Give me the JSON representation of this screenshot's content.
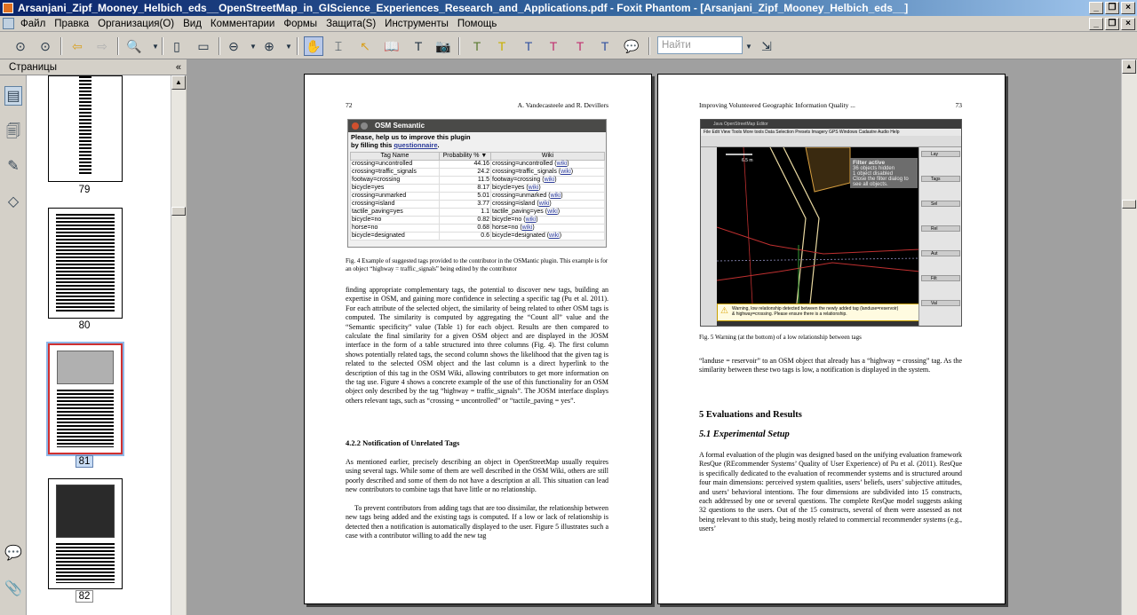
{
  "window": {
    "title": "Arsanjani_Zipf_Mooney_Helbich_eds__OpenStreetMap_in_GIScience_Experiences_Research_and_Applications.pdf - Foxit Phantom - [Arsanjani_Zipf_Mooney_Helbich_eds__]",
    "minimize": "_",
    "restore": "❐",
    "close": "×"
  },
  "menu": {
    "items": [
      "Файл",
      "Правка",
      "Организация(O)",
      "Вид",
      "Комментарии",
      "Формы",
      "Защита(S)",
      "Инструменты",
      "Помощь"
    ]
  },
  "toolbar": {
    "search_placeholder": "Найти",
    "icons": [
      "nav-up-icon",
      "nav-down-icon",
      "back-icon",
      "forward-icon",
      "zoom-icon",
      "fit-page-icon",
      "fit-width-icon",
      "zoom-out-icon",
      "zoom-in-icon",
      "hand-icon",
      "select-text-icon",
      "select-icon",
      "snapshot-icon",
      "typewriter-icon",
      "text-box-icon",
      "highlight-icon",
      "note-icon",
      "underline-icon",
      "strikeout-icon",
      "replace-icon",
      "squiggly-icon",
      "comment-icon"
    ]
  },
  "sidebar": {
    "title": "Страницы",
    "collapse": "«",
    "tabs": [
      "pages-icon",
      "bookmarks-icon",
      "signatures-icon",
      "layers-icon",
      "comments-icon",
      "attachments-icon"
    ],
    "thumbnails": [
      {
        "label": "79"
      },
      {
        "label": "80"
      },
      {
        "label": "81",
        "selected": true
      },
      {
        "label": "82"
      }
    ]
  },
  "left_page": {
    "page_number": "72",
    "running_head": "A. Vandecasteele and R. Devillers",
    "plugin": {
      "title": "OSM Semantic",
      "please_line1": "Please, help us to improve this plugin",
      "please_line2_prefix": "by filling this ",
      "please_link": "questionnaire",
      "please_suffix": ".",
      "columns": [
        "Tag Name",
        "Probability % ▼",
        "Wiki"
      ],
      "rows": [
        [
          "crossing=uncontrolled",
          "44.16",
          "crossing=uncontrolled",
          "wiki"
        ],
        [
          "crossing=traffic_signals",
          "24.2",
          "crossing=traffic_signals",
          "wiki"
        ],
        [
          "footway=crossing",
          "11.5",
          "footway=crossing",
          "wiki"
        ],
        [
          "bicycle=yes",
          "8.17",
          "bicycle=yes",
          "wiki"
        ],
        [
          "crossing=unmarked",
          "5.01",
          "crossing=unmarked",
          "wiki"
        ],
        [
          "crossing=island",
          "3.77",
          "crossing=island",
          "wiki"
        ],
        [
          "tactile_paving=yes",
          "1.1",
          "tactile_paving=yes",
          "wiki"
        ],
        [
          "bicycle=no",
          "0.82",
          "bicycle=no",
          "wiki"
        ],
        [
          "horse=no",
          "0.68",
          "horse=no",
          "wiki"
        ],
        [
          "bicycle=designated",
          "0.6",
          "bicycle=designated",
          "wiki"
        ]
      ]
    },
    "fig4_caption": "Fig. 4  Example of suggested tags provided to the contributor in the OSMantic plugin. This example is for an object “highway = traffic_signals” being edited by the contributor",
    "para1": "finding appropriate complementary tags, the potential to discover new tags, building an expertise in OSM, and gaining more confidence in selecting a specific tag (Pu et al. 2011). For each attribute of the selected object, the similarity of being related to other OSM tags is computed. The similarity is computed by aggregating the “Count all” value and the “Semantic specificity” value (Table 1) for each object. Results are then compared to calculate the final similarity for a given OSM object and are displayed in the JOSM interface in the form of a table structured into three columns (Fig. 4). The first column shows potentially related tags, the second column shows the likelihood that the given tag is related to the selected OSM object and the last column is a direct hyperlink to the description of this tag in the OSM Wiki, allowing contributors to get more information on the tag use. Figure 4 shows a concrete example of the use of this functionality for an OSM object only described by the tag “highway = traffic_signals”. The JOSM interface displays others relevant tags, such as “crossing = uncontrolled” or “tactile_paving = yes”.",
    "heading": "4.2.2  Notification of Unrelated Tags",
    "para2": "As mentioned earlier, precisely describing an object in OpenStreetMap usually requires using several tags. While some of them are well described in the OSM Wiki, others are still poorly described and some of them do not have a description at all. This situation can lead new contributors to combine tags that have little or no relationship.",
    "para3": "To prevent contributors from adding tags that are too dissimilar, the relationship between new tags being added and the existing tags is computed. If a low or lack of relationship is detected then a notification is automatically displayed to the user. Figure 5 illustrates such a case with a contributor willing to add the new tag"
  },
  "right_page": {
    "running_head": "Improving Volunteered Geographic Information Quality ...",
    "page_number": "73",
    "josm": {
      "window_title": "Java OpenStreetMap Editor",
      "menu": "File  Edit  View  Tools  More tools  Data  Selection  Presets  Imagery  GPS  Windows  Cadastre  Audio  Help",
      "filter_title": "Filter active",
      "filter_line1": "36 objects hidden",
      "filter_line2": "1 object disabled",
      "filter_line3": "Close the filter dialog to see all objects.",
      "scale": "6.5 m",
      "warning_line1": "Warning, low relationship detected between the newly added tag (landuse=reservoir)",
      "warning_line2": "& highway=crossing. Please ensure there is a relationship.",
      "panels": [
        "Lay",
        "Tags",
        "Sel",
        "Rel",
        "Aut",
        "Filt",
        "Val"
      ]
    },
    "fig5_caption": "Fig. 5  Warning (at the bottom) of a low relationship between tags",
    "para1": "“landuse = reservoir” to an OSM object that already has a “highway = crossing” tag. As the similarity between these two tags is low, a notification is displayed in the system.",
    "section_heading": "5  Evaluations and Results",
    "subsection_heading": "5.1  Experimental Setup",
    "para2": "A formal evaluation of the plugin was designed based on the unifying evaluation framework ResQue (REcommender Systems’ Quality of User Experience) of Pu et al. (2011). ResQue is specifically dedicated to the evaluation of recommender systems and is structured around four main dimensions: perceived system qualities, users’ beliefs, users’ subjective attitudes, and users’ behavioral intentions. The four dimensions are subdivided into 15 constructs, each addressed by one or several questions. The complete ResQue model suggests asking 32 questions to the users. Out of the 15 constructs, several of them were assessed as not being relevant to this study, being mostly related to commercial recommender systems (e.g., users’"
  }
}
